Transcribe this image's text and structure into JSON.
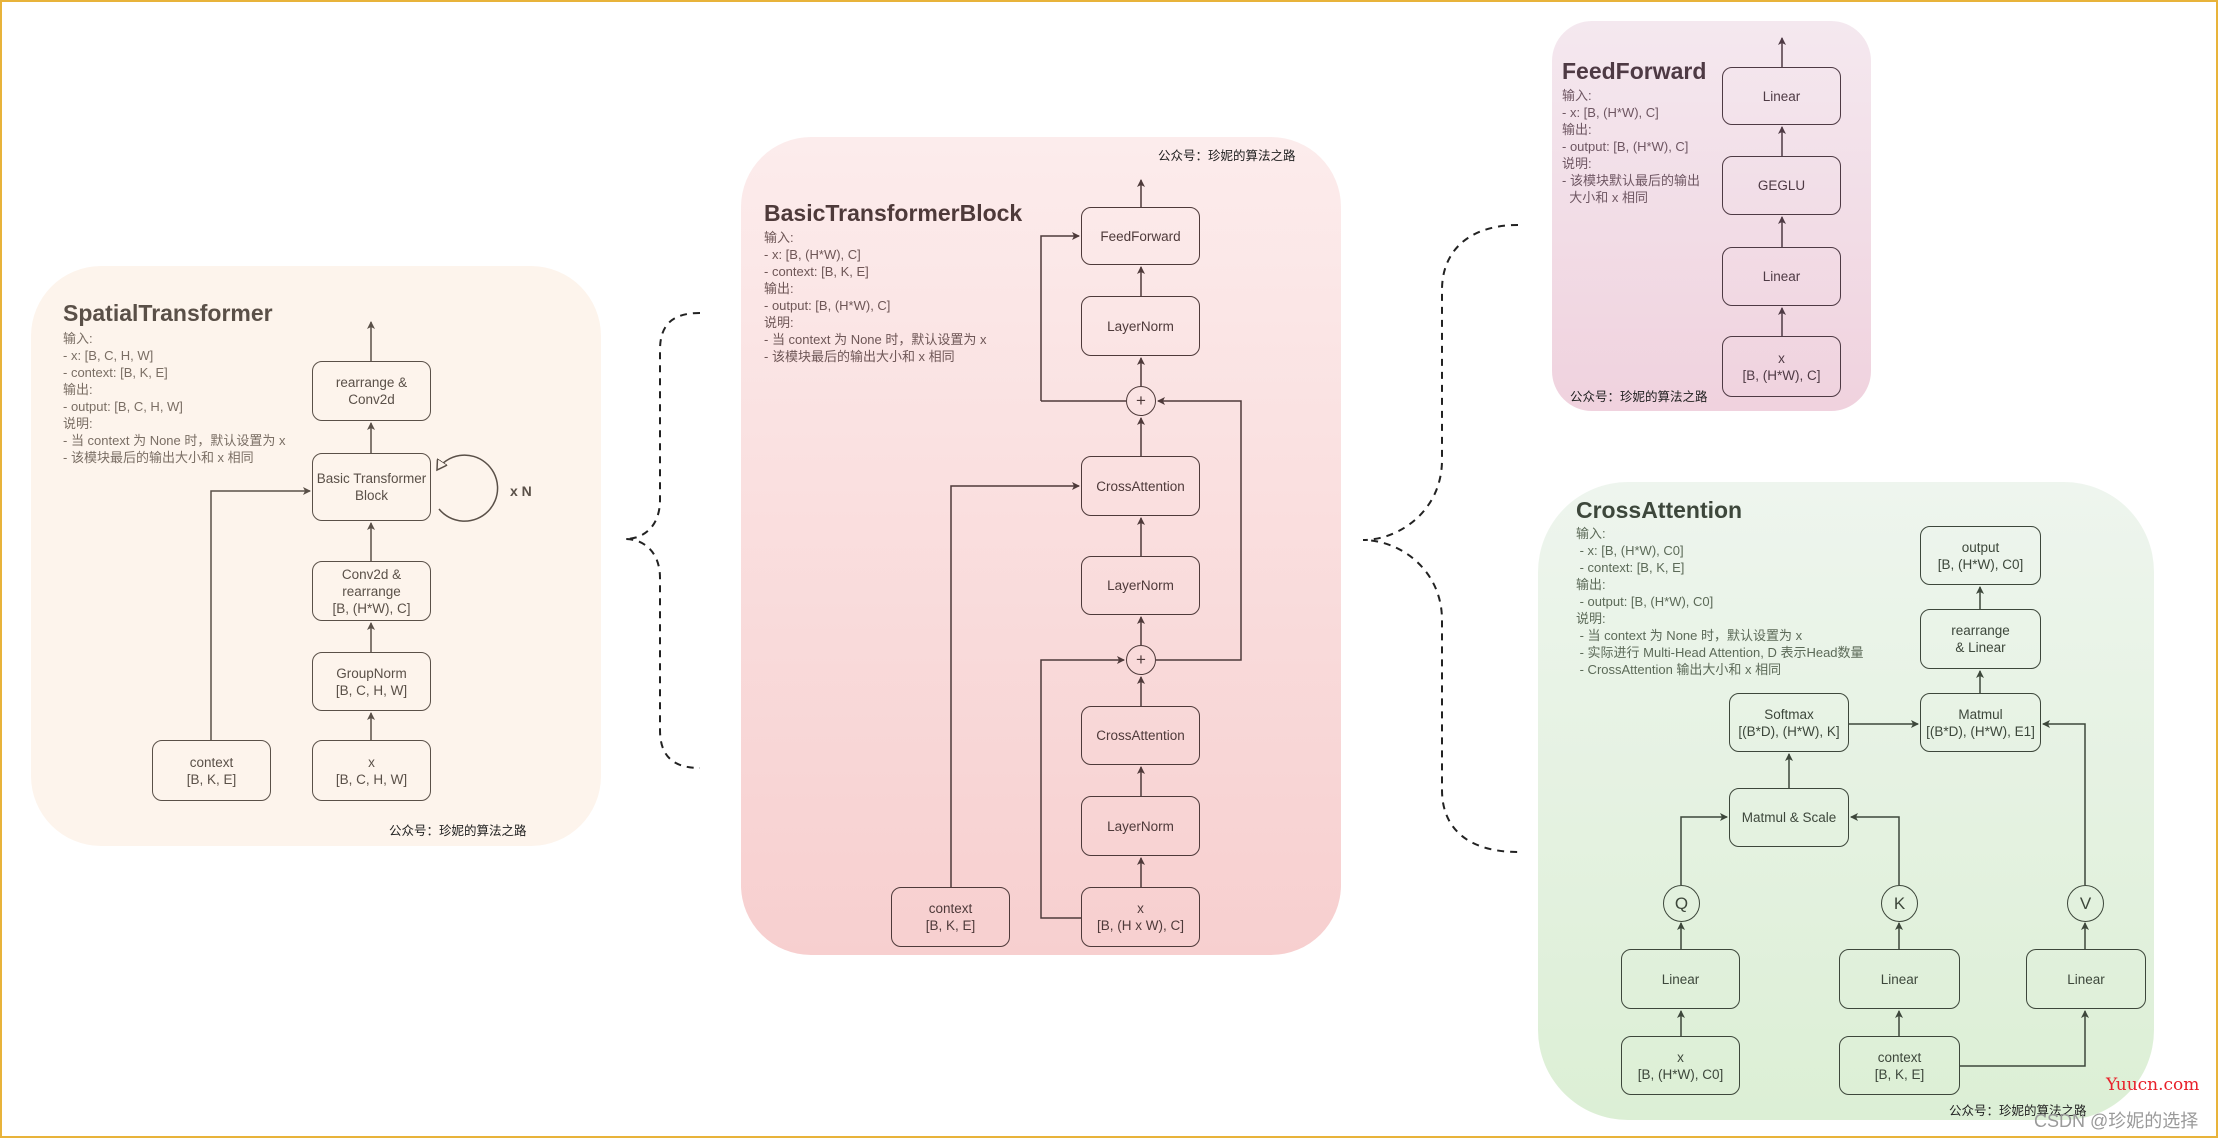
{
  "watermark_label": "公众号：珍妮的算法之路",
  "spatial": {
    "title": "SpatialTransformer",
    "desc": "输入:\n- x: [B, C, H, W]\n- context: [B, K, E]\n输出:\n- output: [B, C, H, W]\n说明:\n- 当 context 为 None 时，默认设置为 x\n- 该模块最后的输出大小和 x 相同",
    "boxes": {
      "rearrange_conv": "rearrange &\nConv2d",
      "basic_block": "Basic Transformer\nBlock",
      "conv_rearrange": "Conv2d &\nrearrange\n[B, (H*W), C]",
      "groupnorm": "GroupNorm\n[B, C, H, W]",
      "x": "x\n[B, C, H, W]",
      "context": "context\n[B, K, E]"
    },
    "repeat_label": "x N"
  },
  "basic": {
    "title": "BasicTransformerBlock",
    "desc": "输入:\n- x: [B, (H*W), C]\n- context: [B, K, E]\n输出:\n- output: [B, (H*W), C]\n说明:\n- 当 context 为 None 时，默认设置为 x\n- 该模块最后的输出大小和 x 相同",
    "boxes": {
      "feedforward": "FeedForward",
      "layernorm3": "LayerNorm",
      "crossattn2": "CrossAttention",
      "layernorm2": "LayerNorm",
      "crossattn1": "CrossAttention",
      "layernorm1": "LayerNorm",
      "x": "x\n[B, (H x W), C]",
      "context": "context\n[B, K, E]"
    },
    "plus_symbol": "+"
  },
  "feedforward": {
    "title": "FeedForward",
    "desc": "输入:\n- x: [B, (H*W), C]\n输出:\n- output: [B, (H*W), C]\n说明:\n- 该模块默认最后的输出\n  大小和 x 相同",
    "boxes": {
      "linear2": "Linear",
      "geglu": "GEGLU",
      "linear1": "Linear",
      "x": "x\n[B, (H*W), C]"
    }
  },
  "crossattention": {
    "title": "CrossAttention",
    "desc": "输入:\n - x: [B, (H*W), C0]\n - context: [B, K, E]\n输出:\n - output: [B, (H*W), C0]\n说明:\n - 当 context 为 None 时，默认设置为 x\n - 实际进行 Multi-Head Attention, D 表示Head数量\n - CrossAttention 输出大小和 x 相同",
    "boxes": {
      "output": "output\n[B, (H*W), C0]",
      "rearrange_linear": "rearrange\n& Linear",
      "matmul": "Matmul\n[(B*D), (H*W), E1]",
      "softmax": "Softmax\n[(B*D), (H*W), K]",
      "matmul_scale": "Matmul & Scale",
      "q": "Q",
      "k": "K",
      "v": "V",
      "linear_q": "Linear",
      "linear_k": "Linear",
      "linear_v": "Linear",
      "x": "x\n[B, (H*W), C0]",
      "context": "context\n[B, K, E]"
    }
  },
  "site_watermark": "Yuucn.com",
  "csdn_watermark": "CSDN @珍妮的选择",
  "colors": {
    "frame": "#e8b33a",
    "spatial_bg": "#fdf4ec",
    "basic_bg": "#f9dede",
    "feedforward_bg": "#f2dde7",
    "crossattention_bg": "#e4f2df",
    "yuucn_red": "#e8202a"
  }
}
